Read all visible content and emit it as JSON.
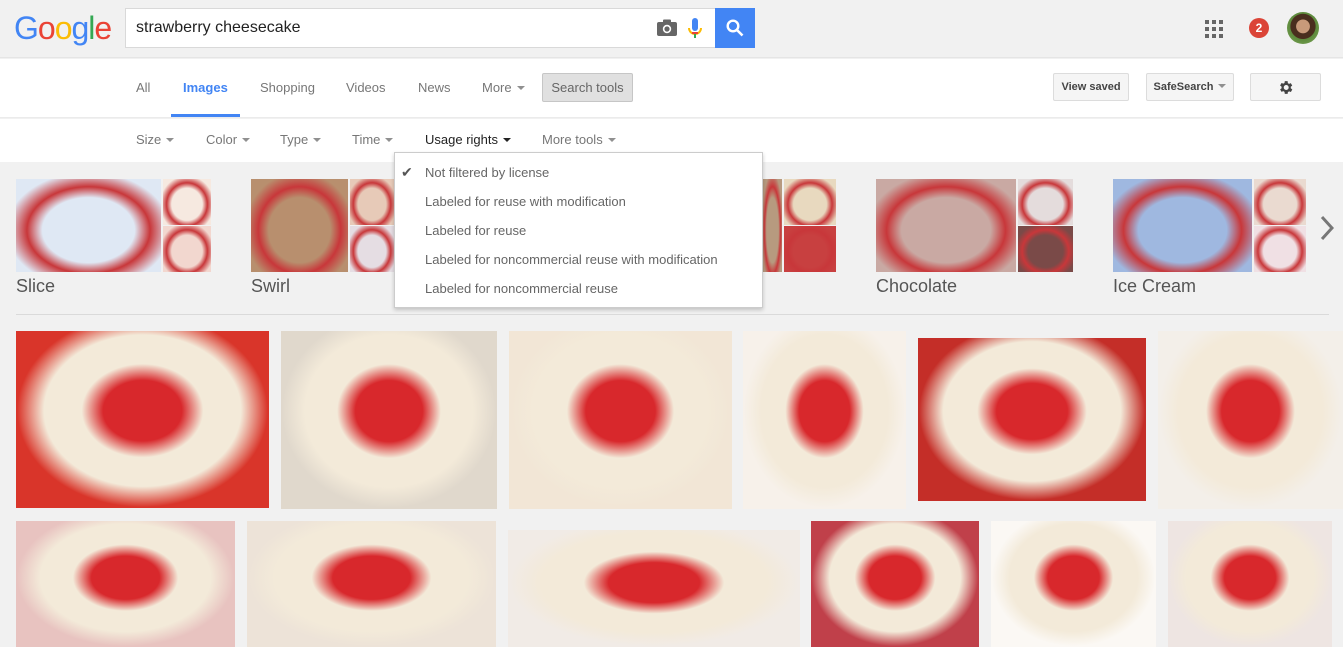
{
  "header": {
    "logo_letters": [
      {
        "char": "G",
        "color": "#4285f4"
      },
      {
        "char": "o",
        "color": "#ea4335"
      },
      {
        "char": "o",
        "color": "#fbbc05"
      },
      {
        "char": "g",
        "color": "#4285f4"
      },
      {
        "char": "l",
        "color": "#34a853"
      },
      {
        "char": "e",
        "color": "#ea4335"
      }
    ],
    "search_query": "strawberry cheesecake",
    "camera_icon": "camera-icon",
    "mic_icon": "microphone-icon",
    "search_icon": "search-icon",
    "apps_icon": "apps-grid-icon",
    "notification_count": "2",
    "avatar_icon": "user-avatar"
  },
  "nav": {
    "tabs": [
      {
        "label": "All",
        "active": false
      },
      {
        "label": "Images",
        "active": true
      },
      {
        "label": "Shopping",
        "active": false
      },
      {
        "label": "Videos",
        "active": false
      },
      {
        "label": "News",
        "active": false
      },
      {
        "label": "More",
        "active": false,
        "dropdown": true
      }
    ],
    "search_tools": "Search tools",
    "view_saved": "View saved",
    "safesearch": "SafeSearch",
    "settings_icon": "gear-icon"
  },
  "tools": {
    "items": [
      {
        "label": "Size"
      },
      {
        "label": "Color"
      },
      {
        "label": "Type"
      },
      {
        "label": "Time"
      },
      {
        "label": "Usage rights",
        "open": true
      },
      {
        "label": "More tools"
      }
    ]
  },
  "usage_rights_menu": {
    "items": [
      {
        "label": "Not filtered by license",
        "checked": true
      },
      {
        "label": "Labeled for reuse with modification",
        "checked": false
      },
      {
        "label": "Labeled for reuse",
        "checked": false
      },
      {
        "label": "Labeled for noncommercial reuse with modification",
        "checked": false
      },
      {
        "label": "Labeled for noncommercial reuse",
        "checked": false
      }
    ]
  },
  "categories": [
    {
      "label": "Slice",
      "colors": [
        "#dfe8f4",
        "#f6e9e0",
        "#f2d7cf"
      ]
    },
    {
      "label": "Swirl",
      "colors": [
        "#b88f6e",
        "#e7cab8",
        "#e5dde3"
      ]
    },
    {
      "label": "",
      "colors": [
        "#b79a7f",
        "#e8d9bf",
        "#c84040"
      ]
    },
    {
      "label": "Chocolate",
      "colors": [
        "#c9a9a3",
        "#e4dcdc",
        "#7a4a48"
      ]
    },
    {
      "label": "Ice Cream",
      "colors": [
        "#9fb8e0",
        "#eadad0",
        "#f0e0e4"
      ]
    }
  ],
  "images": {
    "row1": [
      {
        "alt": "strawberry cheesecake close-up",
        "color": "#d9352a"
      },
      {
        "alt": "strawberry topped cheesecake cut",
        "color": "#e0d8cc"
      },
      {
        "alt": "cheesecake slice with strawberry sauce",
        "color": "#f2e6d6"
      },
      {
        "alt": "cheesecake slice with glaze",
        "color": "#f7f1ea"
      },
      {
        "alt": "cheesecake square on red plate",
        "color": "#c42e28"
      },
      {
        "alt": "strawberry pie slice",
        "color": "#f3efe9"
      }
    ],
    "row2": [
      {
        "alt": "cheesecake with whole strawberries",
        "color": "#e8c3c0"
      },
      {
        "alt": "cheesecake topped with strawberries",
        "color": "#ede3d8"
      },
      {
        "alt": "strawberry layered cake",
        "color": "#f1ebe6"
      },
      {
        "alt": "cheesecake with cherry sauce",
        "color": "#c0404a"
      },
      {
        "alt": "cheesecake slice with strawberries",
        "color": "#fbf8f4"
      },
      {
        "alt": "strawberry cheesecake on stand",
        "color": "#eee5e2"
      }
    ]
  }
}
